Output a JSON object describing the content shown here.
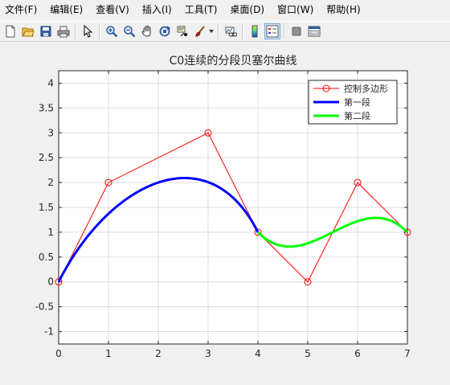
{
  "menu": {
    "items": [
      "文件(F)",
      "编辑(E)",
      "查看(V)",
      "插入(I)",
      "工具(T)",
      "桌面(D)",
      "窗口(W)",
      "帮助(H)"
    ]
  },
  "toolbar": {
    "buttons": [
      "new-figure-icon",
      "open-file-icon",
      "save-icon",
      "print-icon",
      "edit-plot-arrow-icon",
      "zoom-in-icon",
      "zoom-out-icon",
      "pan-hand-icon",
      "rotate-3d-icon",
      "data-cursor-icon",
      "brush-icon",
      "link-plot-icon",
      "colorbar-icon",
      "legend-icon",
      "hide-plot-tools-icon",
      "show-plot-tools-icon"
    ]
  },
  "colors": {
    "control": "#ff0000",
    "segment1": "#0000ff",
    "segment2": "#00ff00",
    "axes_bg": "#ffffff",
    "grid": "#dcdcdc",
    "window_bg": "#f0f0f0"
  },
  "chart_data": {
    "type": "line",
    "title": "C0连续的分段贝塞尔曲线",
    "xlabel": "",
    "ylabel": "",
    "xlim": [
      0,
      7
    ],
    "ylim": [
      -1.25,
      4.25
    ],
    "xticks": [
      0,
      1,
      2,
      3,
      4,
      5,
      6,
      7
    ],
    "yticks": [
      -1,
      -0.5,
      0,
      0.5,
      1,
      1.5,
      2,
      2.5,
      3,
      3.5,
      4
    ],
    "xtick_labels": [
      "0",
      "1",
      "2",
      "3",
      "4",
      "5",
      "6",
      "7"
    ],
    "ytick_labels": [
      "-1",
      "-0.5",
      "0",
      "0.5",
      "1",
      "1.5",
      "2",
      "2.5",
      "3",
      "3.5",
      "4"
    ],
    "grid": true,
    "legend_position": "top-right",
    "series": [
      {
        "name": "控制多边形",
        "kind": "polyline-markers",
        "marker": "circle",
        "color": "#ff0000",
        "x": [
          0,
          1,
          3,
          4,
          5,
          6,
          7
        ],
        "y": [
          0,
          2,
          3,
          1,
          0,
          2,
          1
        ]
      },
      {
        "name": "第一段",
        "kind": "bezier",
        "color": "#0000ff",
        "control_x": [
          0,
          1,
          3,
          4
        ],
        "control_y": [
          0,
          2,
          3,
          1
        ]
      },
      {
        "name": "第二段",
        "kind": "bezier",
        "color": "#00ff00",
        "control_x": [
          4,
          5,
          6,
          7
        ],
        "control_y": [
          1,
          0,
          2,
          1
        ]
      }
    ]
  }
}
